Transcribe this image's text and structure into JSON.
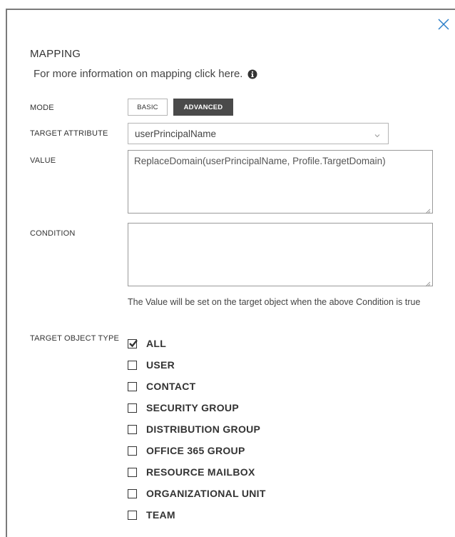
{
  "dialog": {
    "close_icon": "close-icon",
    "heading": "MAPPING",
    "info_text": "For more information on mapping click here.",
    "info_icon": "info-circle-icon"
  },
  "mode": {
    "label": "MODE",
    "options": [
      "BASIC",
      "ADVANCED"
    ],
    "selected": "ADVANCED"
  },
  "target_attribute": {
    "label": "TARGET ATTRIBUTE",
    "value": "userPrincipalName",
    "icon": "chevron-down-icon"
  },
  "value": {
    "label": "VALUE",
    "text": "ReplaceDomain(userPrincipalName, Profile.TargetDomain)"
  },
  "condition": {
    "label": "CONDITION",
    "text": "",
    "hint": "The Value will be set on the target object when the above Condition is true"
  },
  "target_object_type": {
    "label": "TARGET OBJECT TYPE",
    "items": [
      {
        "label": "ALL",
        "checked": true
      },
      {
        "label": "USER",
        "checked": false
      },
      {
        "label": "CONTACT",
        "checked": false
      },
      {
        "label": "SECURITY GROUP",
        "checked": false
      },
      {
        "label": "DISTRIBUTION GROUP",
        "checked": false
      },
      {
        "label": "OFFICE 365 GROUP",
        "checked": false
      },
      {
        "label": "RESOURCE MAILBOX",
        "checked": false
      },
      {
        "label": "ORGANIZATIONAL UNIT",
        "checked": false
      },
      {
        "label": "TEAM",
        "checked": false
      }
    ]
  },
  "colors": {
    "accent": "#2b7fc9",
    "selected_button_bg": "#4a4a4a",
    "text": "#333333"
  }
}
